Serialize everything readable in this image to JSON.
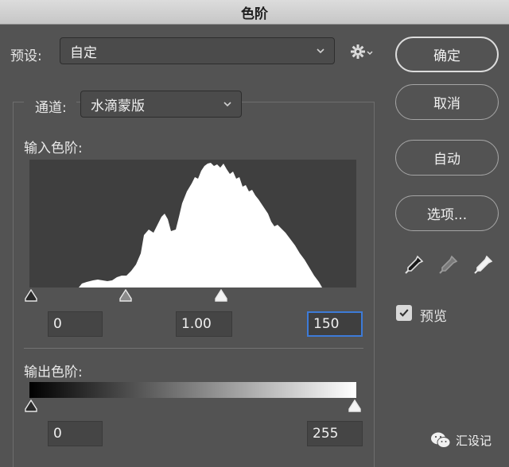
{
  "window": {
    "title": "色阶"
  },
  "preset": {
    "label": "预设:",
    "value": "自定"
  },
  "channel": {
    "label": "通道:",
    "value": "水滴蒙版"
  },
  "input_levels": {
    "label": "输入色阶:",
    "black": "0",
    "gamma": "1.00",
    "white": "150"
  },
  "output_levels": {
    "label": "输出色阶:",
    "black": "0",
    "white": "255"
  },
  "buttons": {
    "ok": "确定",
    "cancel": "取消",
    "auto": "自动",
    "options": "选项..."
  },
  "preview": {
    "label": "预览",
    "checked": true
  },
  "icons": {
    "gear": "gear-icon",
    "chevron": "chevron-down-icon",
    "eyedroppers": [
      "black-eyedropper-icon",
      "gray-eyedropper-icon",
      "white-eyedropper-icon"
    ]
  },
  "watermark": {
    "text": "汇设记"
  },
  "colors": {
    "background": "#535353",
    "histogram_bg": "#3f3f3f",
    "focus": "#3d7bd8"
  }
}
